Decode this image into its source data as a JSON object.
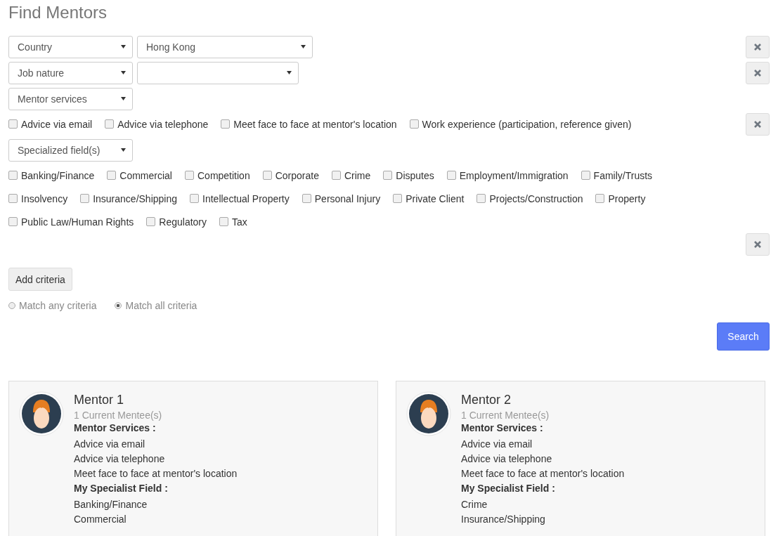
{
  "title": "Find Mentors",
  "criteria": [
    {
      "kind": "select",
      "field": "Country",
      "value": "Hong Kong"
    },
    {
      "kind": "select",
      "field": "Job nature"
    },
    {
      "kind": "options",
      "field": "Mentor services",
      "options": [
        {
          "label": "Advice via email",
          "checked": false
        },
        {
          "label": "Advice via telephone",
          "checked": false
        },
        {
          "label": "Meet face to face at mentor's location",
          "checked": false
        },
        {
          "label": "Work experience (participation, reference given)",
          "checked": false
        }
      ]
    },
    {
      "kind": "options",
      "field": "Specialized field(s)",
      "options": [
        {
          "label": "Banking/Finance",
          "checked": false
        },
        {
          "label": "Commercial",
          "checked": false
        },
        {
          "label": "Competition",
          "checked": false
        },
        {
          "label": "Corporate",
          "checked": false
        },
        {
          "label": "Crime",
          "checked": false
        },
        {
          "label": "Disputes",
          "checked": false
        },
        {
          "label": "Employment/Immigration",
          "checked": false
        },
        {
          "label": "Family/Trusts",
          "checked": false
        },
        {
          "label": "Insolvency",
          "checked": false
        },
        {
          "label": "Insurance/Shipping",
          "checked": false
        },
        {
          "label": "Intellectual Property",
          "checked": false
        },
        {
          "label": "Personal Injury",
          "checked": false
        },
        {
          "label": "Private Client",
          "checked": false
        },
        {
          "label": "Projects/Construction",
          "checked": false
        },
        {
          "label": "Property",
          "checked": false
        },
        {
          "label": "Public Law/Human Rights",
          "checked": false
        },
        {
          "label": "Regulatory",
          "checked": false
        },
        {
          "label": "Tax",
          "checked": false
        }
      ]
    }
  ],
  "add_button": "Add criteria",
  "match_modes": [
    {
      "label": "Match any criteria",
      "selected": false
    },
    {
      "label": "Match all criteria",
      "selected": true
    }
  ],
  "search_button": "Search",
  "mentors": [
    {
      "name": "Mentor 1",
      "mentees": "1 Current Mentee(s)",
      "services_heading": "Mentor Services :",
      "services": [
        "Advice via email",
        "Advice via telephone",
        "Meet face to face at mentor's location"
      ],
      "fields_heading": "My Specialist Field :",
      "fields": [
        "Banking/Finance",
        "Commercial"
      ]
    },
    {
      "name": "Mentor 2",
      "mentees": "1 Current Mentee(s)",
      "services_heading": "Mentor Services :",
      "services": [
        "Advice via email",
        "Advice via telephone",
        "Meet face to face at mentor's location"
      ],
      "fields_heading": "My Specialist Field :",
      "fields": [
        "Crime",
        "Insurance/Shipping"
      ]
    }
  ]
}
